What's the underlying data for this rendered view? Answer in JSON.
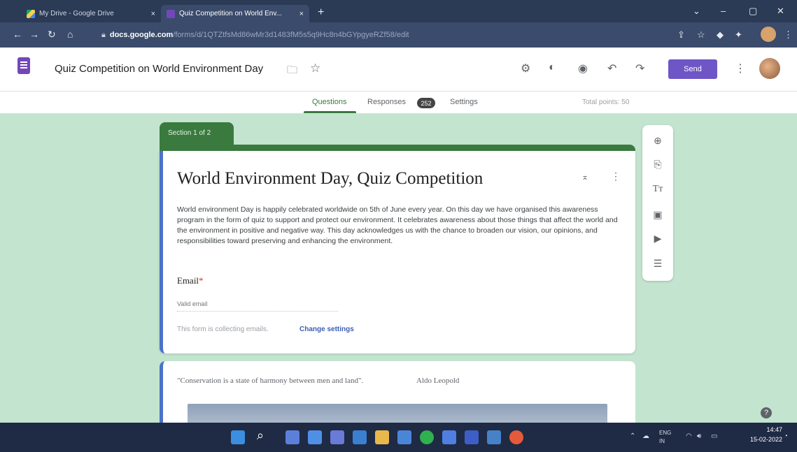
{
  "browser": {
    "tabs": [
      {
        "label": "My Drive - Google Drive",
        "close": "×"
      },
      {
        "label": "Quiz Competition on World Env...",
        "close": "×"
      }
    ],
    "new_tab": "+",
    "url_domain": "docs.google.com",
    "url_path": "/forms/d/1QTZtfsMd86wMr3d1483fM5s5q9Hc8n4bGYpgyeRZf58/edit"
  },
  "header": {
    "title": "Quiz Competition on World Environment Day",
    "send_label": "Send"
  },
  "form_tabs": {
    "questions": "Questions",
    "responses": "Responses",
    "responses_count": "252",
    "settings": "Settings",
    "total_points": "Total points: 50"
  },
  "section": {
    "label": "Section 1 of 2"
  },
  "form": {
    "title": "World Environment Day, Quiz Competition",
    "description": "World environment Day is happily celebrated worldwide on 5th of June every year. On this day we have organised this awareness program in the form of quiz to support and protect our environment. It celebrates awareness about those things that affect the world and the environment in positive and negative way. This day acknowledges us with the chance to broaden our vision, our opinions, and responsibilities toward preserving and enhancing the environment.",
    "email_label": "Email",
    "email_required": "*",
    "email_placeholder": "Valid email",
    "collecting_note": "This form is collecting emails.",
    "change_settings": "Change settings"
  },
  "card2": {
    "quote": "\"Conservation is a state of harmony between men and land\".",
    "author": "Aldo Leopold"
  },
  "toolbar_icons": [
    "add-question-icon",
    "import-questions-icon",
    "add-title-icon",
    "add-image-icon",
    "add-video-icon",
    "add-section-icon"
  ],
  "taskbar": {
    "lang_top": "ENG",
    "lang_bottom": "IN",
    "time": "14:47",
    "date": "15-02-2022"
  },
  "colors": {
    "theme_green": "#3a7a3e",
    "accent_purple": "#6f56c6",
    "background_mint": "#c3e4cf",
    "card_border_blue": "#4a73c9"
  }
}
